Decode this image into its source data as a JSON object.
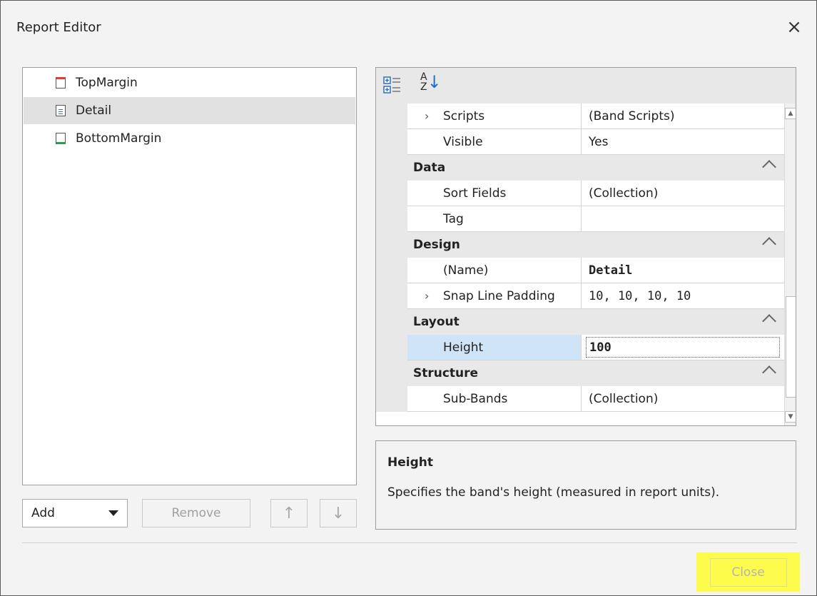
{
  "window": {
    "title": "Report Editor",
    "close_glyph": "×"
  },
  "tree": {
    "items": [
      {
        "label": "TopMargin",
        "icon": "top-margin-band-icon"
      },
      {
        "label": "Detail",
        "icon": "detail-band-icon",
        "selected": true
      },
      {
        "label": "BottomMargin",
        "icon": "bottom-margin-band-icon"
      }
    ]
  },
  "controls": {
    "add_label": "Add",
    "remove_label": "Remove",
    "up_glyph": "↑",
    "down_glyph": "↓"
  },
  "toolbar": {
    "sort_glyph": "A Z ↓"
  },
  "properties": {
    "rows": [
      {
        "name": "Scripts",
        "value": "(Band Scripts)",
        "expandable": true
      },
      {
        "name": "Visible",
        "value": "Yes"
      },
      {
        "category": "Data"
      },
      {
        "name": "Sort Fields",
        "value": "(Collection)"
      },
      {
        "name": "Tag",
        "value": ""
      },
      {
        "category": "Design"
      },
      {
        "name": "(Name)",
        "value": "Detail",
        "bold": true
      },
      {
        "name": "Snap Line Padding",
        "value": "10, 10, 10, 10",
        "expandable": true
      },
      {
        "category": "Layout"
      },
      {
        "name": "Height",
        "value": "100",
        "selected": true
      },
      {
        "category": "Structure"
      },
      {
        "name": "Sub-Bands",
        "value": "(Collection)"
      }
    ]
  },
  "description": {
    "title": "Height",
    "text": "Specifies the band's height (measured in report units)."
  },
  "footer": {
    "close_label": "Close"
  },
  "colors": {
    "highlight": "#fdfb4b",
    "selection": "#cfe4f7"
  }
}
